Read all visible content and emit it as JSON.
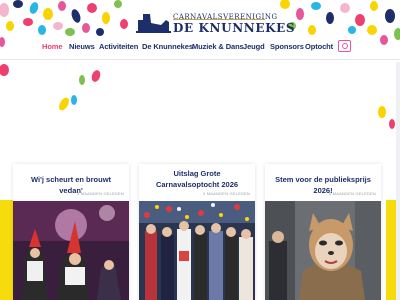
{
  "site": {
    "logo_line1": "CARNAVALSVERENIGING",
    "logo_line2": "DE KNUNNEKES"
  },
  "nav": {
    "items": [
      {
        "label": "Home",
        "active": true
      },
      {
        "label": "Nieuws"
      },
      {
        "label": "Activiteiten"
      },
      {
        "label": "De Knunnekes"
      },
      {
        "label": "Muziek & Dans"
      },
      {
        "label": "Jeugd"
      },
      {
        "label": "Sponsors"
      },
      {
        "label": "Optocht"
      }
    ],
    "camera_icon": "camera-icon"
  },
  "colors": {
    "navy": "#1d2f6b",
    "accent": "#ef3f6f",
    "yellow": "#f7dc0d",
    "gold": "#c6a24a"
  },
  "cards": [
    {
      "title": "Wi'j scheurt en brouwt vedan'",
      "meta": "3 MAANDEN GELEDEN"
    },
    {
      "title": "Uitslag Grote Carnavalsoptocht 2026",
      "meta": "3 MAANDEN GELEDEN"
    },
    {
      "title": "Stem voor de publieksprijs 2026!",
      "meta": "3 MAANDEN GELEDEN"
    }
  ]
}
